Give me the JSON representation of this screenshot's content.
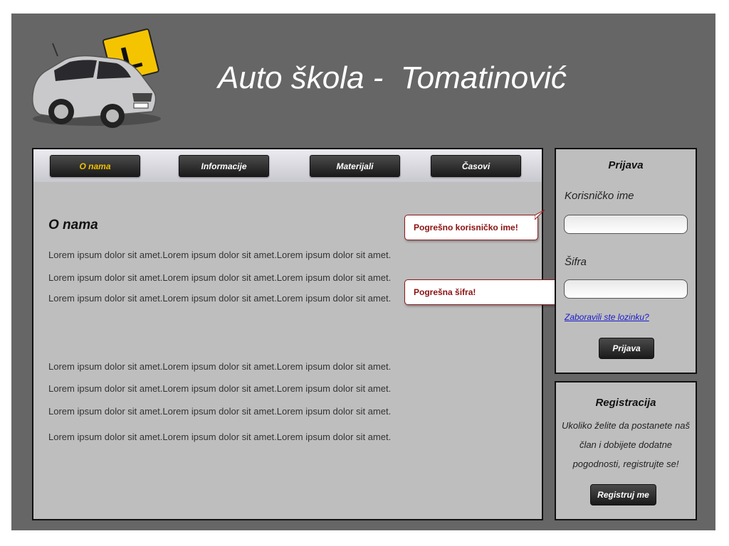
{
  "header": {
    "title": "Auto škola -  Tomatinović",
    "logo_sign_letter": "L"
  },
  "nav": {
    "items": [
      {
        "label": "O nama",
        "active": true
      },
      {
        "label": "Informacije",
        "active": false
      },
      {
        "label": "Materijali",
        "active": false
      },
      {
        "label": "Časovi",
        "active": false
      }
    ]
  },
  "main": {
    "heading": "O nama",
    "paragraphs_top": [
      "Lorem ipsum dolor sit amet.Lorem ipsum dolor sit amet.Lorem ipsum dolor sit amet.",
      "Lorem ipsum dolor sit amet.Lorem ipsum dolor sit amet.Lorem ipsum dolor sit amet.",
      "Lorem ipsum dolor sit amet.Lorem ipsum dolor sit amet.Lorem ipsum dolor sit amet."
    ],
    "paragraphs_bottom": [
      "Lorem ipsum dolor sit amet.Lorem ipsum dolor sit amet.Lorem ipsum dolor sit amet.",
      "Lorem ipsum dolor sit amet.Lorem ipsum dolor sit amet.Lorem ipsum dolor sit amet.",
      "Lorem ipsum dolor sit amet.Lorem ipsum dolor sit amet.Lorem ipsum dolor sit amet.",
      "Lorem ipsum dolor sit amet.Lorem ipsum dolor sit amet.Lorem ipsum dolor sit amet."
    ]
  },
  "errors": {
    "username": "Pogrešno korisničko ime!",
    "password": "Pogrešna šifra!"
  },
  "login": {
    "title": "Prijava",
    "username_label": "Korisničko ime",
    "username_value": "",
    "password_label": "Šifra",
    "password_value": "",
    "forgot_link": "Zaboravili ste lozinku?",
    "submit_label": "Prijava"
  },
  "register": {
    "title": "Registracija",
    "text": "Ukoliko želite da postanete naš član i dobijete dodatne pogodnosti, registrujte se!",
    "button_label": "Registruj me"
  },
  "colors": {
    "page_bg": "#666666",
    "panel_bg": "#bebebe",
    "active_nav": "#f2c200",
    "error_text": "#8b1010",
    "link": "#1a1acc"
  }
}
